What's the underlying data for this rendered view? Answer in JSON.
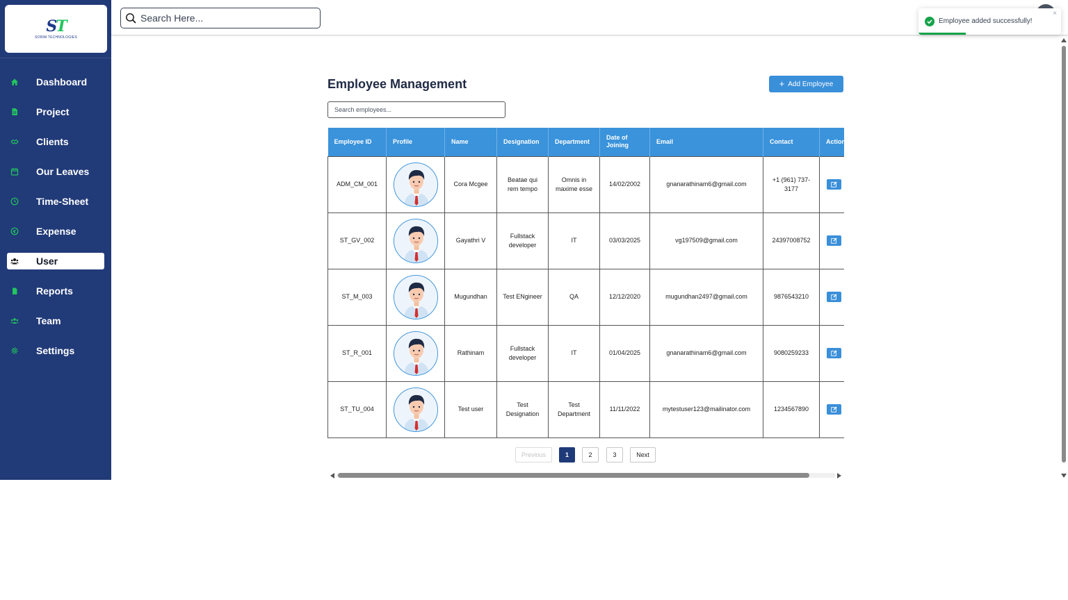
{
  "brand": {
    "logo_mark": "ST",
    "name": "SORIM TECHNOLOGIES"
  },
  "topbar": {
    "search_placeholder": "Search Here..."
  },
  "toast": {
    "message": "Employee added successfully!",
    "close_label": "×",
    "progress": 0.33
  },
  "sidebar": {
    "items": [
      {
        "label": "Dashboard",
        "icon": "home-icon",
        "active": false
      },
      {
        "label": "Project",
        "icon": "document-icon",
        "active": false
      },
      {
        "label": "Clients",
        "icon": "handshake-icon",
        "active": false
      },
      {
        "label": "Our Leaves",
        "icon": "calendar-icon",
        "active": false
      },
      {
        "label": "Time-Sheet",
        "icon": "clock-icon",
        "active": false
      },
      {
        "label": "Expense",
        "icon": "currency-icon",
        "active": false
      },
      {
        "label": "User",
        "icon": "users-icon",
        "active": true
      },
      {
        "label": "Reports",
        "icon": "report-icon",
        "active": false
      },
      {
        "label": "Team",
        "icon": "team-icon",
        "active": false
      },
      {
        "label": "Settings",
        "icon": "gear-icon",
        "active": false
      }
    ]
  },
  "main": {
    "title": "Employee Management",
    "add_button": "Add Employee",
    "search_placeholder": "Search employees...",
    "columns": [
      "Employee ID",
      "Profile",
      "Name",
      "Designation",
      "Department",
      "Date of Joining",
      "Email",
      "Contact",
      "Action"
    ],
    "rows": [
      {
        "id": "ADM_CM_001",
        "name": "Cora Mcgee",
        "designation": "Beatae qui rem tempo",
        "department": "Omnis in maxime esse",
        "doj": "14/02/2002",
        "email": "gnanarathinam6@gmail.com",
        "contact": "+1 (961) 737-3177"
      },
      {
        "id": "ST_GV_002",
        "name": "Gayathri V",
        "designation": "Fullstack developer",
        "department": "IT",
        "doj": "03/03/2025",
        "email": "vg197509@gmail.com",
        "contact": "24397008752"
      },
      {
        "id": "ST_M_003",
        "name": "Mugundhan",
        "designation": "Test ENgineer",
        "department": "QA",
        "doj": "12/12/2020",
        "email": "mugundhan2497@gmail.com",
        "contact": "9876543210"
      },
      {
        "id": "ST_R_001",
        "name": "Rathinam",
        "designation": "Fullstack developer",
        "department": "IT",
        "doj": "01/04/2025",
        "email": "gnanarathinam6@gmail.com",
        "contact": "9080259233"
      },
      {
        "id": "ST_TU_004",
        "name": "Test user",
        "designation": "Test Designation",
        "department": "Test Department",
        "doj": "11/11/2022",
        "email": "mytestuser123@mailinator.com",
        "contact": "1234567890"
      }
    ],
    "pagination": {
      "previous": "Previous",
      "pages": [
        "1",
        "2",
        "3"
      ],
      "current": "1",
      "next": "Next"
    }
  },
  "colors": {
    "sidebar_bg": "#213a78",
    "accent": "#3a93db",
    "icon_green": "#22c55e",
    "success": "#16a34a"
  }
}
